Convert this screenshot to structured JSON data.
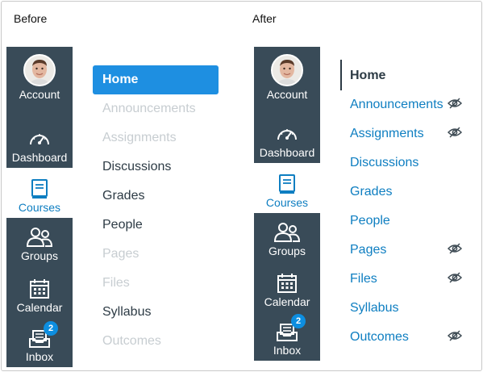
{
  "labels": {
    "before": "Before",
    "after": "After"
  },
  "global_nav": {
    "account": "Account",
    "dashboard": "Dashboard",
    "courses": "Courses",
    "groups": "Groups",
    "calendar": "Calendar",
    "inbox": "Inbox",
    "inbox_badge": "2"
  },
  "before_nav": {
    "home": "Home",
    "items": [
      {
        "label": "Announcements",
        "state": "disabled"
      },
      {
        "label": "Assignments",
        "state": "disabled"
      },
      {
        "label": "Discussions",
        "state": "enabled"
      },
      {
        "label": "Grades",
        "state": "enabled"
      },
      {
        "label": "People",
        "state": "enabled"
      },
      {
        "label": "Pages",
        "state": "disabled"
      },
      {
        "label": "Files",
        "state": "disabled"
      },
      {
        "label": "Syllabus",
        "state": "enabled"
      },
      {
        "label": "Outcomes",
        "state": "disabled"
      }
    ]
  },
  "after_nav": {
    "home": "Home",
    "items": [
      {
        "label": "Announcements",
        "hidden_icon": true
      },
      {
        "label": "Assignments",
        "hidden_icon": true
      },
      {
        "label": "Discussions",
        "hidden_icon": false
      },
      {
        "label": "Grades",
        "hidden_icon": false
      },
      {
        "label": "People",
        "hidden_icon": false
      },
      {
        "label": "Pages",
        "hidden_icon": true
      },
      {
        "label": "Files",
        "hidden_icon": true
      },
      {
        "label": "Syllabus",
        "hidden_icon": false
      },
      {
        "label": "Outcomes",
        "hidden_icon": true
      }
    ]
  },
  "colors": {
    "rail": "#394b58",
    "active_blue": "#0e7ec1",
    "home_button": "#1e8fe1",
    "disabled_text": "#c7cdd1",
    "text_dark": "#2d3b45"
  },
  "icons": [
    "avatar",
    "dashboard-gauge-icon",
    "courses-book-icon",
    "groups-people-icon",
    "calendar-icon",
    "inbox-tray-icon",
    "eye-slash-icon"
  ]
}
